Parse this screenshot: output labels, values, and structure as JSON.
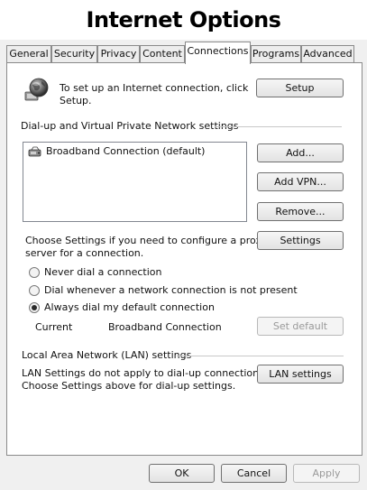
{
  "window": {
    "title": "Internet Options"
  },
  "tabs": [
    {
      "label": "General"
    },
    {
      "label": "Security"
    },
    {
      "label": "Privacy"
    },
    {
      "label": "Content"
    },
    {
      "label": "Connections"
    },
    {
      "label": "Programs"
    },
    {
      "label": "Advanced"
    }
  ],
  "active_tab": "Connections",
  "setup": {
    "text_line1": "To set up an Internet connection, click",
    "text_line2": "Setup.",
    "button": "Setup",
    "icon": "globe-network-icon"
  },
  "dialup": {
    "heading": "Dial-up and Virtual Private Network settings",
    "connections": [
      {
        "label": "Broadband Connection (default)",
        "icon": "broadband-connection-icon"
      }
    ],
    "add_button": "Add...",
    "add_vpn_button": "Add VPN...",
    "remove_button": "Remove...",
    "settings_text_line1": "Choose Settings if you need to configure a proxy",
    "settings_text_line2": "server for a connection.",
    "settings_button": "Settings",
    "options": [
      {
        "label": "Never dial a connection",
        "selected": false
      },
      {
        "label": "Dial whenever a network connection is not present",
        "selected": false
      },
      {
        "label": "Always dial my default connection",
        "selected": true
      }
    ],
    "current_label": "Current",
    "current_value": "Broadband Connection",
    "set_default_button": "Set default"
  },
  "lan": {
    "heading": "Local Area Network (LAN) settings",
    "text_line1": "LAN Settings do not apply to dial-up connections.",
    "text_line2": "Choose Settings above for dial-up settings.",
    "button": "LAN settings"
  },
  "footer": {
    "ok": "OK",
    "cancel": "Cancel",
    "apply": "Apply"
  }
}
